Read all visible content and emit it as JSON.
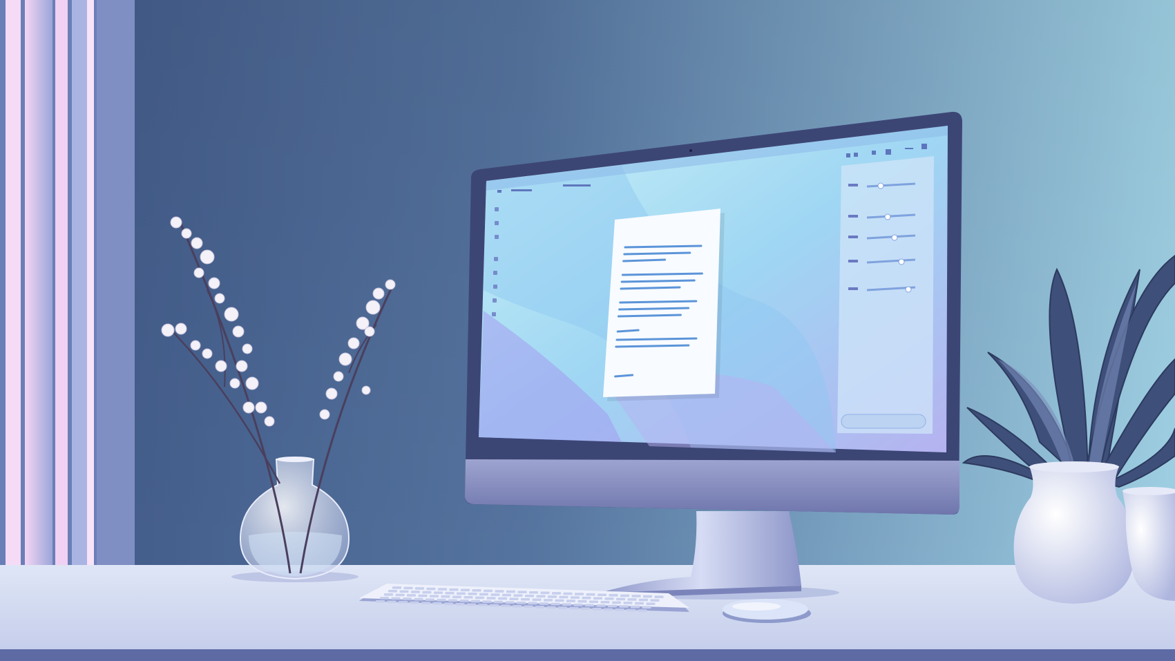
{
  "scene": {
    "description_visible_text": "",
    "colors": {
      "wall_dark": "#3f5786",
      "wall_light": "#9fd0e4",
      "desk": "#c9d1ec",
      "monitor_frame": "#3c4675",
      "screen_light": "#bfe8f5",
      "screen_violet": "#a9a6ef",
      "accent_pink": "#f3c6f0"
    },
    "objects": [
      {
        "name": "window-light",
        "kind": "light-strips"
      },
      {
        "name": "flower-vase",
        "kind": "glass-vase-with-blossoms"
      },
      {
        "name": "monitor",
        "kind": "desktop-computer"
      },
      {
        "name": "keyboard",
        "kind": "wireless-keyboard"
      },
      {
        "name": "mouse",
        "kind": "wireless-mouse"
      },
      {
        "name": "potted-plant",
        "kind": "plant-in-white-pot"
      },
      {
        "name": "second-pot",
        "kind": "white-pot"
      }
    ],
    "screen_ui": {
      "document_lines": 13,
      "panel_sliders": 5
    }
  }
}
